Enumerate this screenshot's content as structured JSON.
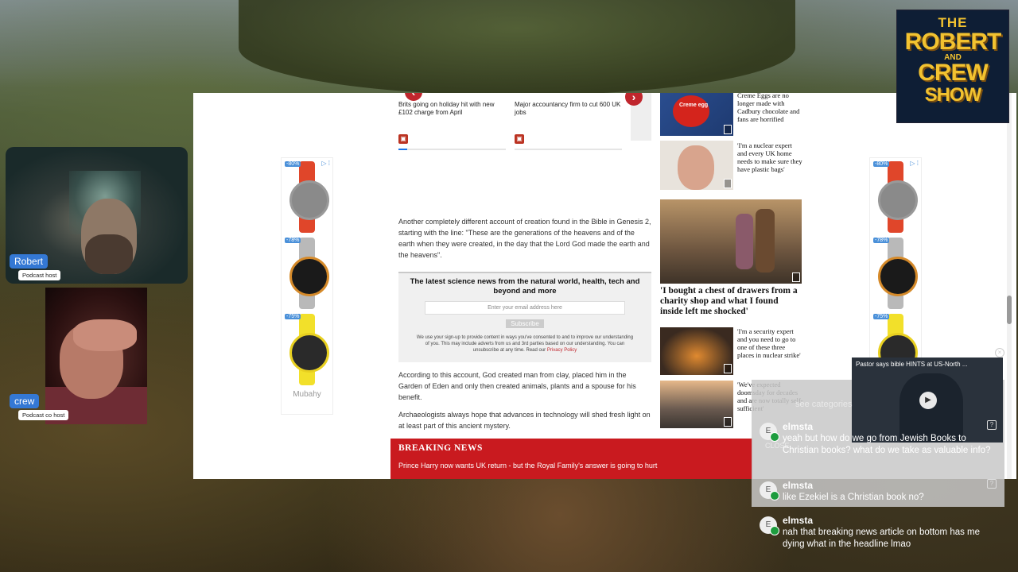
{
  "colors": {
    "brand_red": "#c91a1f",
    "tag_blue": "#3478d4",
    "chat_online": "#1d9c3e"
  },
  "carousel": {
    "cards": [
      {
        "title": "Brits going on holiday hit with new £102 charge from April",
        "progress": 0.08
      },
      {
        "title": "Major accountancy firm to cut 600 UK jobs",
        "progress": 0
      }
    ],
    "prev_icon": "chevron-left-icon",
    "next_icon": "chevron-right-icon"
  },
  "article": {
    "para1": "Another completely different account of creation found in the Bible in Genesis 2, starting with the line: \"These are the generations of the heavens and of the earth when they were created, in the day that the Lord God made the earth and the heavens\".",
    "para2": "According to this account, God created man from clay, placed him in the Garden of Eden and only then created animals, plants and a spouse for his benefit.",
    "para3": "Archaeologists always hope that advances in technology will shed fresh light on at least part of this ancient mystery."
  },
  "signup": {
    "heading": "The latest science news from the natural world, health, tech and beyond and more",
    "placeholder": "Enter your email address here",
    "button": "Subscribe",
    "fine_print": "We use your sign-up to provide content in ways you've consented to and to improve our understanding of you. This may include adverts from us and 3rd parties based on our understanding. You can unsubscribe at any time. Read our",
    "privacy_link": "Privacy Policy"
  },
  "breaking": {
    "label": "BREAKING NEWS",
    "headline": "Prince Harry now wants UK return - but the Royal Family's answer is going to hurt"
  },
  "sidebar": {
    "items": [
      {
        "text": "Creme Eggs are no longer made with Cadbury chocolate and fans are horrified",
        "thumb_label": "Creme egg"
      },
      {
        "text": "'I'm a nuclear expert and every UK home needs to make sure they have plastic bags'"
      },
      {
        "text": "'I bought a chest of drawers from a charity shop and what I found inside left me shocked'"
      },
      {
        "text": "'I'm a security expert and you need to go to one of these three places in nuclear strike'"
      },
      {
        "text": "'We've expected doomsday for decades and are now totally self-sufficient'"
      }
    ]
  },
  "ads": {
    "left": {
      "brand": "Mubahy",
      "badges": [
        "-80%",
        "-78%",
        "-75%"
      ]
    },
    "right": {
      "badges": [
        "-80%",
        "-78%",
        "-75%"
      ]
    }
  },
  "hosts": [
    {
      "name": "Robert",
      "role": "Podcast host"
    },
    {
      "name": "crew",
      "role": "Podcast co host"
    }
  ],
  "logo": {
    "line1": "THE",
    "line2a": "ROBERT",
    "line2b": "AND",
    "line3": "CREW",
    "line4": "SHOW"
  },
  "mini_player": {
    "title": "Pastor says bible HINTS at US-North ..."
  },
  "overlay": {
    "see_categories": "see categories",
    "close": "CLOSE"
  },
  "chat": [
    {
      "user": "elmsta",
      "initial": "E",
      "text": "yeah but how do we go from Jewish Books to Christian books? what do we take as valuable info?"
    },
    {
      "user": "elmsta",
      "initial": "E",
      "text": "like Ezekiel is a Christian book no?"
    },
    {
      "user": "elmsta",
      "initial": "E",
      "text": "nah that breaking news article on bottom has me dying what in the headline lmao"
    }
  ]
}
